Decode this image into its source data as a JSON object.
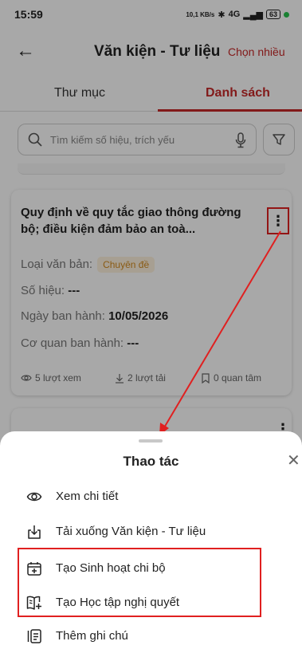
{
  "status_bar": {
    "time": "15:59",
    "net_speed": "10,1 KB/s",
    "signal": "4G",
    "battery": "63"
  },
  "app_bar": {
    "title": "Văn kiện - Tư liệu",
    "action": "Chọn nhiều"
  },
  "tabs": [
    {
      "label": "Thư mục",
      "active": false
    },
    {
      "label": "Danh sách",
      "active": true
    }
  ],
  "search": {
    "placeholder": "Tìm kiếm số hiệu, trích yếu"
  },
  "card": {
    "title": "Quy định về quy tắc giao thông đường bộ; điều kiện đảm bảo an toà...",
    "type_label": "Loại văn bản:",
    "type_value": "Chuyên đề",
    "number_label": "Số hiệu:",
    "number_value": "---",
    "date_label": "Ngày ban hành:",
    "date_value": "10/05/2026",
    "agency_label": "Cơ quan ban hành:",
    "agency_value": "---",
    "views": "5 lượt xem",
    "downloads": "2 lượt tải",
    "follows": "0 quan tâm"
  },
  "sheet": {
    "title": "Thao tác",
    "actions": [
      {
        "label": "Xem chi tiết",
        "icon": "eye-icon"
      },
      {
        "label": "Tải xuống Văn kiện - Tư liệu",
        "icon": "download-icon"
      },
      {
        "label": "Tạo Sinh hoạt chi bộ",
        "icon": "calendar-plus-icon"
      },
      {
        "label": "Tạo Học tập nghị quyết",
        "icon": "book-plus-icon"
      },
      {
        "label": "Thêm ghi chú",
        "icon": "note-icon"
      }
    ]
  },
  "colors": {
    "accent": "#c62828",
    "annotation": "#e02020",
    "chip_bg": "#fdf1de",
    "chip_text": "#d28a1e"
  }
}
